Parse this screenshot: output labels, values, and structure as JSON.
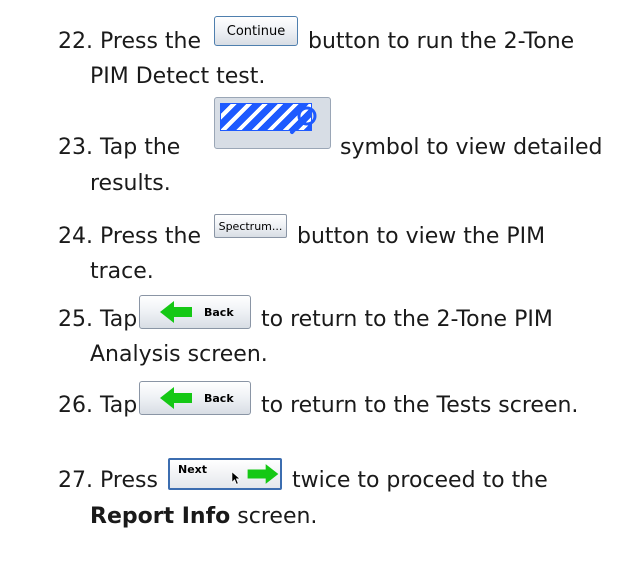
{
  "steps": [
    {
      "number": "22.",
      "before": "Press the",
      "button": "Continue",
      "after": "button to run the 2-Tone",
      "line2": "PIM Detect test."
    },
    {
      "number": "23.",
      "before": "Tap the",
      "button": "",
      "after": "symbol to view detailed",
      "line2": "results."
    },
    {
      "number": "24.",
      "before": "Press the",
      "button": "Spectrum...",
      "after": "button to view the PIM",
      "line2": "trace."
    },
    {
      "number": "25.",
      "before": "Tap",
      "button": "Back",
      "after": "to return to the 2-Tone PIM",
      "line2": "Analysis screen."
    },
    {
      "number": "26.",
      "before": "Tap",
      "button": "Back",
      "after": "to return to the Tests screen.",
      "line2": ""
    },
    {
      "number": "27.",
      "before": "Press",
      "button": "Next",
      "after": "twice to proceed to the",
      "line2_bold": "Report Info",
      "line2_rest": "screen."
    }
  ],
  "colors": {
    "arrow_green": "#15c815",
    "status_blue": "#1e5aff",
    "button_border": "#8a95a5"
  },
  "icons": {
    "status_symbol": "magnifier-icon",
    "back_arrow": "arrow-left-icon",
    "next_arrow": "arrow-right-icon",
    "cursor": "mouse-pointer-icon"
  }
}
